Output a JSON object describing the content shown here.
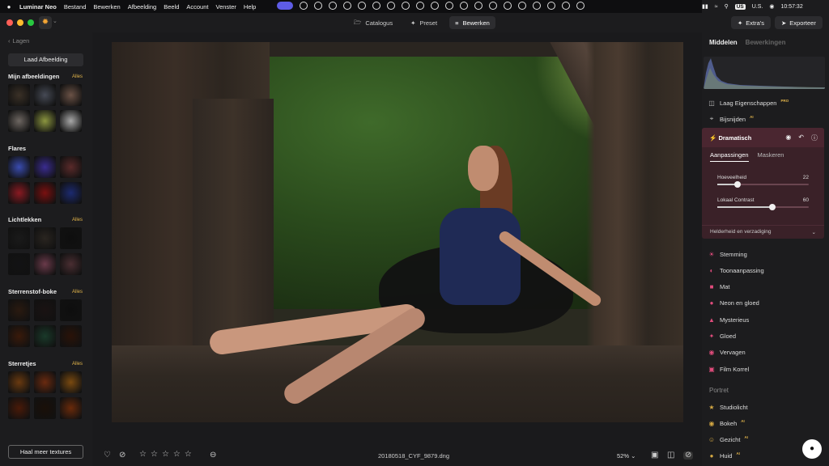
{
  "menubar": {
    "app_name": "Luminar Neo",
    "menus": [
      "Bestand",
      "Bewerken",
      "Afbeelding",
      "Beeld",
      "Account",
      "Venster",
      "Help"
    ],
    "keyboard": "US",
    "keyboard_region": "U.S.",
    "clock": "10:57:32"
  },
  "toolbar": {
    "tabs": [
      {
        "label": "Catalogus",
        "icon": "folder-icon"
      },
      {
        "label": "Preset",
        "icon": "magic-wand-icon"
      },
      {
        "label": "Bewerken",
        "icon": "sliders-icon"
      }
    ],
    "active_tab": "Bewerken",
    "extras_label": "Extra's",
    "export_label": "Exporteer"
  },
  "left_panel": {
    "back_label": "Lagen",
    "load_button": "Laad Afbeelding",
    "sections": [
      {
        "title": "Mijn afbeeldingen",
        "link": "Alles",
        "thumbs": [
          "#3b3127",
          "#464a55",
          "#6b5246",
          "#6e6762",
          "#8c9640",
          "#a8a8a8"
        ]
      },
      {
        "title": "Flares",
        "link": "",
        "thumbs": [
          "#3a4cb0",
          "#3a2c90",
          "#5a2a2a",
          "#8a1a22",
          "#7a1010",
          "#1c2a70"
        ]
      },
      {
        "title": "Lichtlekken",
        "link": "Alles",
        "thumbs": [
          "#1a1a1a",
          "#2a2520",
          "#0e0e0e",
          "#121214",
          "#6a3a4a",
          "#4a2e32"
        ]
      },
      {
        "title": "Sterrenstof-boke",
        "link": "Alles",
        "thumbs": [
          "#2a1a10",
          "#1a1212",
          "#0e0e0e",
          "#3a1a0a",
          "#1a3a2a",
          "#2a1208"
        ]
      },
      {
        "title": "Sterretjes",
        "link": "Alles",
        "thumbs": [
          "#6a3a10",
          "#6a2a10",
          "#7a4a10",
          "#4a1a08",
          "#1a1008",
          "#6a2a0a"
        ]
      }
    ],
    "more_button": "Haal meer textures"
  },
  "bottom_bar": {
    "filename": "20180518_CYF_9879.dng",
    "zoom": "52%",
    "rating_stars": 5
  },
  "right_panel": {
    "tabs": [
      "Middelen",
      "Bewerkingen"
    ],
    "active_tab": "Middelen",
    "tools_top": [
      {
        "label": "Laag Eigenschappen",
        "badge": "PRO",
        "icon": "layers-icon"
      },
      {
        "label": "Bijsnijden",
        "badge": "AI",
        "icon": "crop-icon"
      }
    ],
    "active_tool": {
      "title": "Dramatisch",
      "tabs": [
        "Aanpassingen",
        "Maskeren"
      ],
      "active_subtab": "Aanpassingen",
      "sliders": [
        {
          "label": "Hoeveelheid",
          "value": 22,
          "fraction": 0.22
        },
        {
          "label": "Lokaal Contrast",
          "value": 60,
          "fraction": 0.6
        }
      ],
      "footer": "Helderheid en verzadiging"
    },
    "creative_tools": [
      {
        "label": "Stemming",
        "icon": "mood-icon"
      },
      {
        "label": "Toonaanpassing",
        "icon": "toning-icon"
      },
      {
        "label": "Mat",
        "icon": "matte-icon"
      },
      {
        "label": "Neon en gloed",
        "icon": "neon-icon"
      },
      {
        "label": "Mysterieus",
        "icon": "mystical-icon"
      },
      {
        "label": "Gloed",
        "icon": "glow-icon"
      },
      {
        "label": "Vervagen",
        "icon": "blur-icon"
      },
      {
        "label": "Film Korrel",
        "icon": "film-icon"
      }
    ],
    "portrait_section": "Portret",
    "portrait_tools": [
      {
        "label": "Studiolicht",
        "badge": "",
        "icon": "studio-light-icon"
      },
      {
        "label": "Bokeh",
        "badge": "AI",
        "icon": "bokeh-icon"
      },
      {
        "label": "Gezicht",
        "badge": "AI",
        "icon": "face-icon"
      },
      {
        "label": "Huid",
        "badge": "AI",
        "icon": "skin-icon"
      }
    ]
  }
}
